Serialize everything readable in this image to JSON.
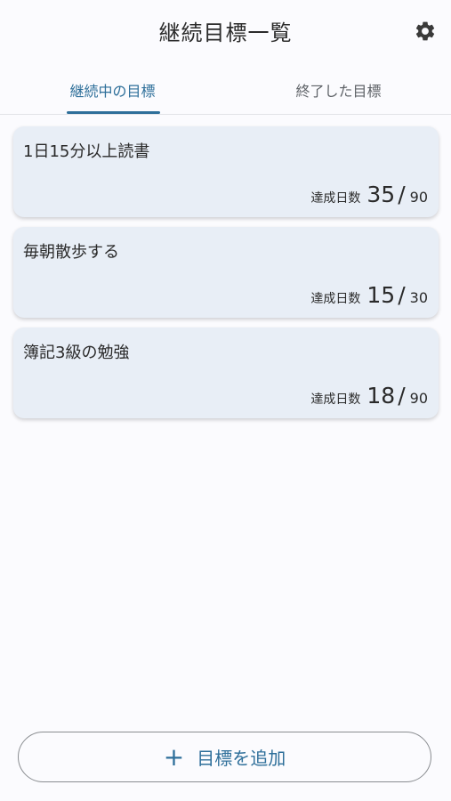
{
  "header": {
    "title": "継続目標一覧",
    "settings_icon": "gear-icon"
  },
  "tabs": [
    {
      "label": "継続中の目標",
      "active": true
    },
    {
      "label": "終了した目標",
      "active": false
    }
  ],
  "goals": [
    {
      "title": "1日15分以上読書",
      "progress_label": "達成日数",
      "done": "35",
      "total": "90"
    },
    {
      "title": "毎朝散歩する",
      "progress_label": "達成日数",
      "done": "15",
      "total": "30"
    },
    {
      "title": "簿記3級の勉強",
      "progress_label": "達成日数",
      "done": "18",
      "total": "90"
    }
  ],
  "add_button": {
    "icon": "+",
    "label": "目標を追加"
  },
  "colors": {
    "accent": "#2e6f9a",
    "card_bg": "#e8eef6",
    "page_bg": "#fbfbfe"
  }
}
